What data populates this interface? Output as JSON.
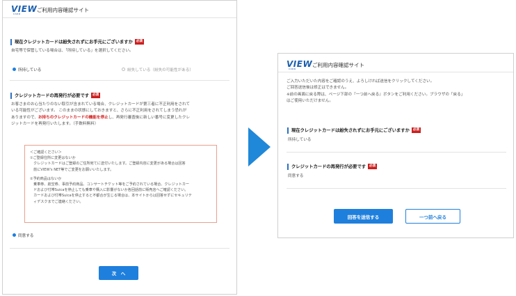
{
  "left": {
    "logo": "VIEW",
    "logo_sub": "CARD",
    "title": "ご利用内容確認サイト",
    "q1": {
      "heading": "現在クレジットカードは紛失されずにお手元にございますか",
      "badge": "必須",
      "description": "自宅等で保管している場合は、「所持している」を選択してください。",
      "option_yes": "所持している",
      "option_no": "紛失している（紛失の可能性がある）",
      "selected": "所持している"
    },
    "q2": {
      "heading": "クレジットカードの再発行が必要です",
      "badge": "必須",
      "body_1": "お客さまのお心当たりのない取引が含まれている場合、クレジットカードが第三者に不正利用をされて",
      "body_2": "いる可能性がございます。 このままの状態にしておきますと、さらに不正利用をされてしまう恐れが",
      "body_3a": "ありますので、",
      "body_3_red": "お持ちのクレジットカードの機能を停止",
      "body_3b": "し、再発行審査後に新しい番号に変更したクレ",
      "body_4": "ジットカードを再発行いたします。（手数料無料）",
      "notice": {
        "title": "＜ご確認ください＞",
        "item1_title": "①ご登録住所に変更はないか",
        "item1_l1": "　クレジットカードはご登録のご住所宛てに送付いたします。ご登録内容に変更がある場合は回答",
        "item1_l2": "　前にVIEW's NET等でご変更をお願いいたします。",
        "item2_title": "②予約商品はないか",
        "item2_l1": "　乗車券、航空券、事前予約商品、コンサートチケット等をご予約されている場合、クレジットカー",
        "item2_l2": "　ドおよび付帯Suicaを停止しても乗車や購入に影響がないか各回話前に販売店へご確認ください。",
        "item2_l3": "　カードおよび付帯Suicaを停止すると不都合が生じる場合は、本サイトからは回答せずにセキュリテ",
        "item2_l4": "　ィデスクまでご連絡ください。"
      },
      "agree": "同意する"
    },
    "next_button": "次　へ"
  },
  "right": {
    "logo": "VIEW",
    "logo_sub": "CARD",
    "title": "ご利用内容確認サイト",
    "intro_1": "ご入力いただいた内容をご確認のうえ、よろしければ送信をクリックしてください。",
    "intro_2": "ご回答送信後は修正はできません。",
    "intro_3": "※前の画面に戻る際は、ページ下部の『一つ前へ戻る』ボタンをご利用ください。ブラウザの「戻る」",
    "intro_4": "はご使用いただけません。",
    "q1_heading": "現在クレジットカードは紛失されずにお手元にございますか",
    "q1_badge": "必須",
    "q1_answer": "所持している",
    "q2_heading": "クレジットカードの再発行が必要です",
    "q2_badge": "必須",
    "q2_answer": "同意する",
    "submit_button": "回答を送信する",
    "back_button": "一つ前へ戻る"
  },
  "colors": {
    "accent": "#1f7fdc",
    "badge": "#cc1f1f",
    "notice_border": "#e8a090",
    "logo": "#1c5fae"
  }
}
